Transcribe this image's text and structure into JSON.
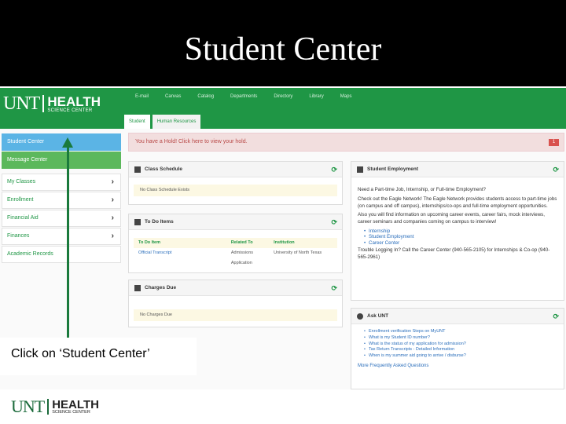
{
  "slide": {
    "title": "Student Center",
    "caption": "Click on ‘Student Center’"
  },
  "brand": {
    "unt": "UNT",
    "health": "HEALTH",
    "science_center": "SCIENCE CENTER",
    "green": "#1f9645"
  },
  "nav": {
    "links": [
      "E-mail",
      "Canvas",
      "Catalog",
      "Departments",
      "Directory",
      "Library",
      "Maps"
    ]
  },
  "tabs": [
    "Student",
    "Human Resources"
  ],
  "sidebar": {
    "items": [
      {
        "label": "Student Center",
        "chevron": false
      },
      {
        "label": "Message Center",
        "chevron": false
      },
      {
        "label": "My Classes",
        "chevron": true
      },
      {
        "label": "Enrollment",
        "chevron": true
      },
      {
        "label": "Financial Aid",
        "chevron": true
      },
      {
        "label": "Finances",
        "chevron": true
      },
      {
        "label": "Academic Records",
        "chevron": false
      }
    ]
  },
  "hold": {
    "text": "You have a Hold! Click here to view your hold.",
    "count": "1"
  },
  "class_schedule": {
    "title": "Class Schedule",
    "empty": "No Class Schedule Exists"
  },
  "todo": {
    "title": "To Do Items",
    "columns": [
      "To Do Item",
      "Related To",
      "Institution"
    ],
    "rows": [
      [
        "Official Transcript",
        "Admissions Application",
        "University of North Texas"
      ]
    ]
  },
  "charges": {
    "title": "Charges Due",
    "empty": "No Charges Due"
  },
  "employment": {
    "title": "Student Employment",
    "p1": "Need a Part-time Job, Internship, or Full-time Employment?",
    "p2": "Check out the Eagle Network! The Eagle Network provides students access to part-time jobs (on campus and off campus), internships/co-ops and full-time employment opportunities.",
    "p3": "Also you will find information on upcoming career events, career fairs, mock interviews, career seminars and companies coming on campus to interview!",
    "links": [
      "Internship",
      "Student Employment",
      "Career Center"
    ],
    "p4": "Trouble Logging In? Call the Career Center (940-565-2105) for Internships & Co-op (940-565-2961)"
  },
  "ask": {
    "title": "Ask UNT",
    "links": [
      "Enrollment verification Steps on MyUNT",
      "What is my Student ID number?",
      "What is the status of my application for admission?",
      "Tax Return Transcripts - Detailed Information",
      "When is my summer aid going to arrive / disburse?"
    ],
    "more": "More Frequently Asked Questions"
  }
}
